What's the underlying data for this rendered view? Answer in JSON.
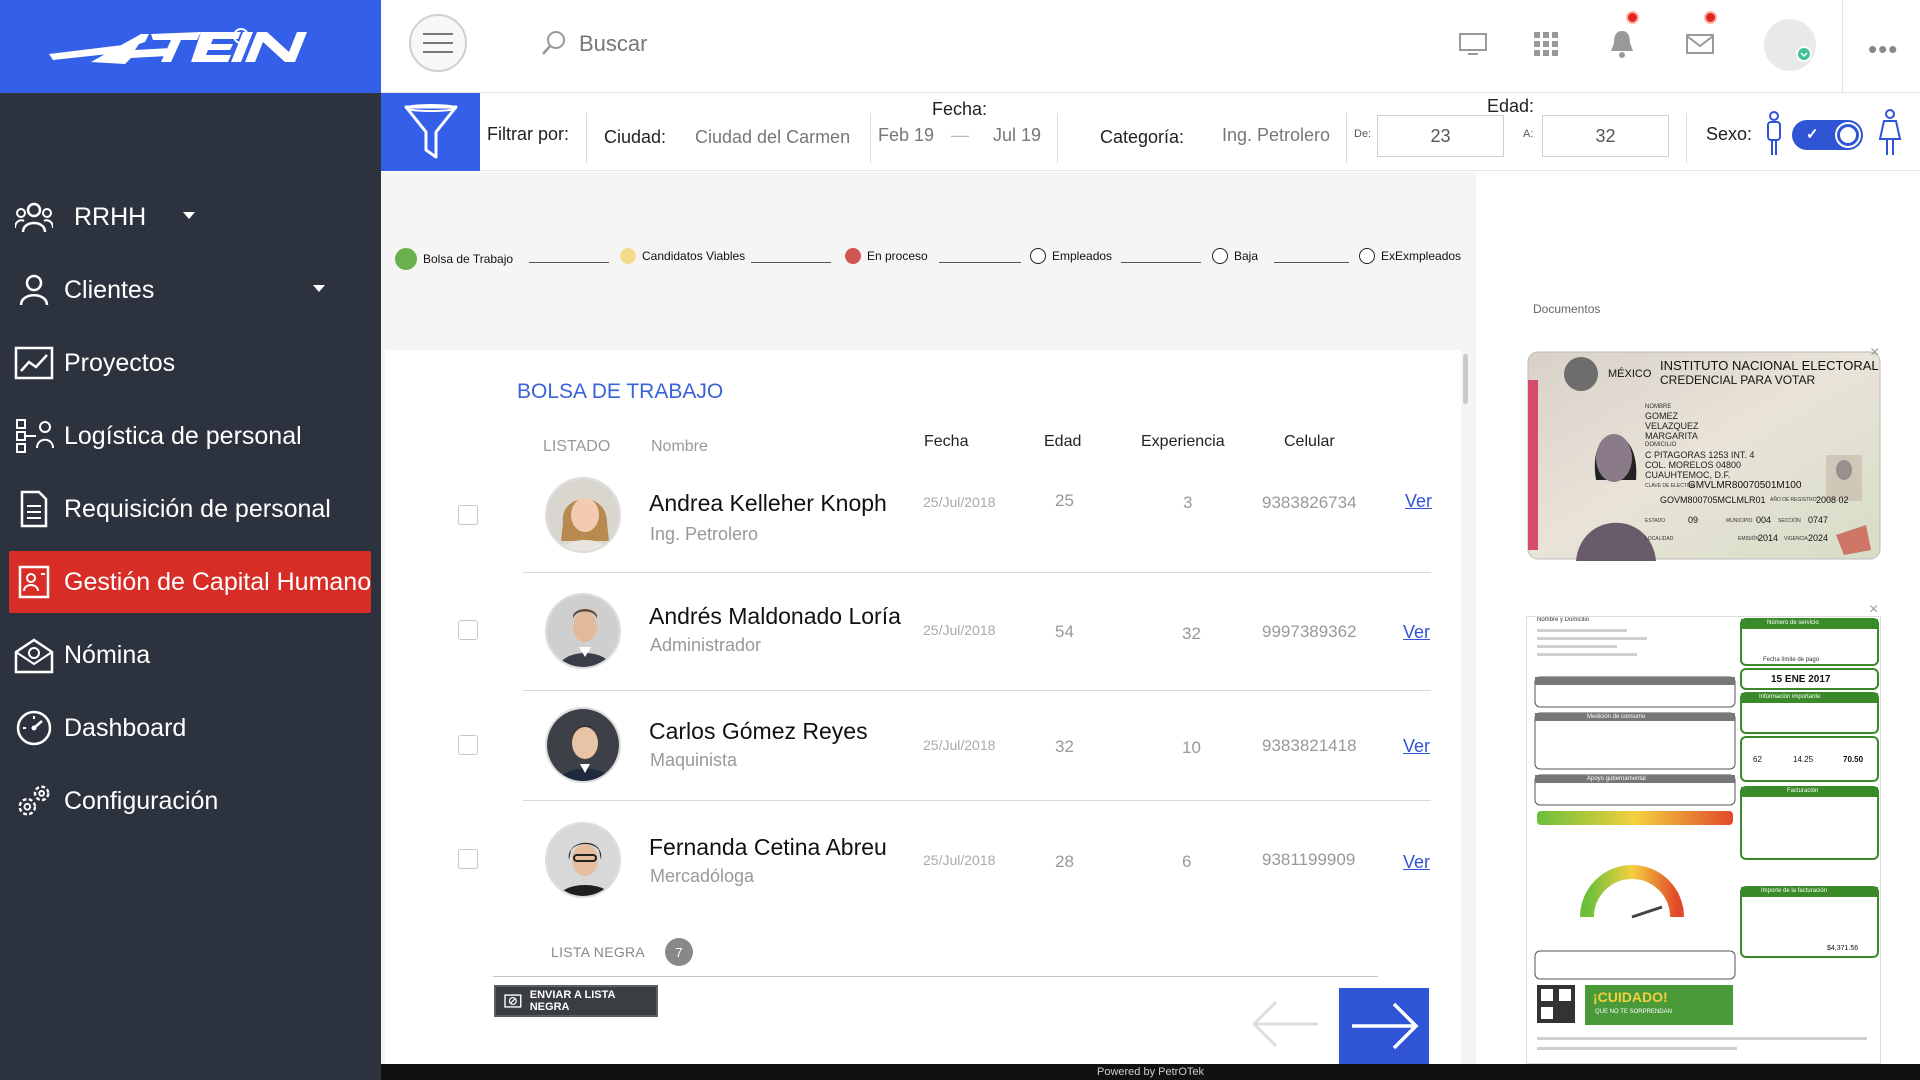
{
  "sidebar": {
    "items": [
      {
        "label": "RRHH",
        "icon": "people-icon",
        "has_caret": true
      },
      {
        "label": "Clientes",
        "icon": "user-icon",
        "has_caret": true
      },
      {
        "label": "Proyectos",
        "icon": "chart-icon"
      },
      {
        "label": "Logística de personal",
        "icon": "logistics-icon"
      },
      {
        "label": "Requisición de personal",
        "icon": "document-icon"
      },
      {
        "label": "Gestión de Capital Humano",
        "icon": "id-card-icon",
        "active": true
      },
      {
        "label": "Nómina",
        "icon": "payroll-icon"
      },
      {
        "label": "Dashboard",
        "icon": "gauge-icon"
      },
      {
        "label": "Configuración",
        "icon": "gears-icon"
      }
    ],
    "active_color": "#d72d26"
  },
  "topbar": {
    "search_placeholder": "Buscar",
    "icons": [
      "monitor-icon",
      "grid-icon",
      "bell-icon",
      "mail-icon",
      "avatar",
      "more-icon"
    ]
  },
  "filters": {
    "filter_by_label": "Filtrar por:",
    "city_label": "Ciudad:",
    "city_value": "Ciudad del Carmen",
    "date_label": "Fecha:",
    "date_from": "Feb 19",
    "date_sep": "—",
    "date_to": "Jul 19",
    "category_label": "Categoría:",
    "category_value": "Ing. Petrolero",
    "age_label": "Edad:",
    "age_from_label": "De:",
    "age_from": "23",
    "age_to_label": "A:",
    "age_to": "32",
    "sex_label": "Sexo:",
    "sex_toggle_on": true
  },
  "steps": [
    {
      "label": "Bolsa de Trabajo",
      "color": "#6ab04c"
    },
    {
      "label": "Candidatos Viables",
      "color": "#f3dc8e"
    },
    {
      "label": "En proceso",
      "color": "#cf5550"
    },
    {
      "label": "Empleados",
      "color": ""
    },
    {
      "label": "Baja",
      "color": ""
    },
    {
      "label": "ExExmpleados",
      "color": ""
    }
  ],
  "list": {
    "title": "BOLSA DE TRABAJO",
    "columns": {
      "listado": "LISTADO",
      "nombre": "Nombre",
      "fecha": "Fecha",
      "edad": "Edad",
      "experiencia": "Experiencia",
      "celular": "Celular"
    },
    "rows": [
      {
        "name": "Andrea Kelleher Knoph",
        "role": "Ing. Petrolero",
        "date": "25/Jul/2018",
        "age": "25",
        "experience": "3",
        "phone": "9383826734",
        "link": "Ver"
      },
      {
        "name": "Andrés Maldonado Loría",
        "role": "Administrador",
        "date": "25/Jul/2018",
        "age": "54",
        "experience": "32",
        "phone": "9997389362",
        "link": "Ver"
      },
      {
        "name": "Carlos Gómez Reyes",
        "role": "Maquinista",
        "date": "25/Jul/2018",
        "age": "32",
        "experience": "10",
        "phone": "9383821418",
        "link": "Ver"
      },
      {
        "name": "Fernanda Cetina Abreu",
        "role": "Mercadóloga",
        "date": "25/Jul/2018",
        "age": "28",
        "experience": "6",
        "phone": "9381199909",
        "link": "Ver"
      }
    ],
    "blacklist_label": "LISTA NEGRA",
    "blacklist_count": "7",
    "blacklist_button": "ENVIAR A LISTA NEGRA"
  },
  "documents": {
    "label": "Documentos",
    "ine": {
      "country": "MÉXICO",
      "institution": "INSTITUTO NACIONAL ELECTORAL",
      "subtitle": "CREDENCIAL PARA VOTAR",
      "name_label": "NOMBRE",
      "name_lines": [
        "GOMEZ",
        "VELAZQUEZ",
        "MARGARITA"
      ],
      "address_label": "DOMICILIO",
      "address_lines": [
        "C PITAGORAS 1253 INT. 4",
        "COL. MORELOS 04800",
        "CUAUHTEMOC, D.F."
      ],
      "key_label": "CLAVE DE ELECTOR",
      "key_value": "GMVLMR80070501M100",
      "curp": "GOVM800705MCLMLR01",
      "registro_label": "AÑO DE REGISTRO",
      "registro": "2008 02",
      "estado_label": "ESTADO",
      "estado": "09",
      "municipio_label": "MUNICIPIO",
      "municipio": "004",
      "seccion_label": "SECCIÓN",
      "seccion": "0747",
      "localidad_label": "LOCALIDAD",
      "emision_label": "EMISIÓN",
      "emision": "2014",
      "vigencia_label": "VIGENCIA",
      "vigencia": "2024"
    },
    "bill": {
      "header_left": "Nombre y Domicilio",
      "service_number_label": "Número de servicio",
      "due_label": "Fecha límite de pago",
      "due_date": "15 ENE 2017",
      "info_label": "Información importante",
      "consumption_label": "Medición de consumo",
      "support_label": "Apoyo gubernamental",
      "billing_label": "Facturación",
      "total_label": "Importe de la facturación",
      "warning_text": "¡CUIDADO!",
      "warning_sub": "QUE NO TE SORPRENDAN",
      "period_values": [
        "62",
        "14.25",
        "70.50"
      ],
      "total_value": "$4,371.56"
    }
  },
  "footer": {
    "text": "Powered by PetrOTek"
  }
}
